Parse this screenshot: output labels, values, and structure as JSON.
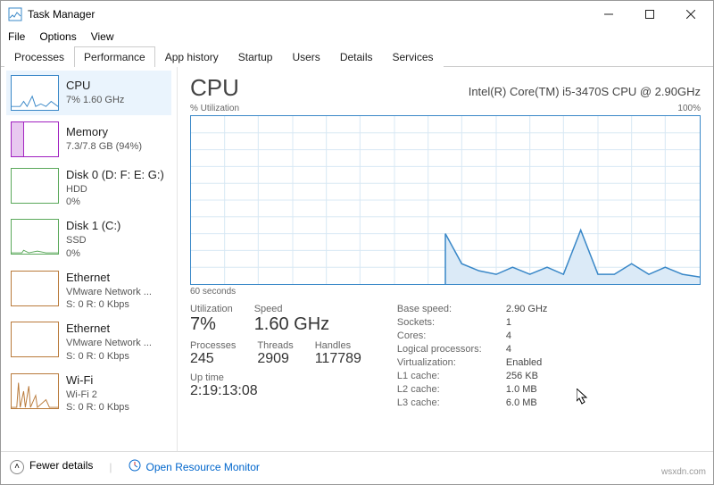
{
  "window": {
    "title": "Task Manager"
  },
  "menu": {
    "file": "File",
    "options": "Options",
    "view": "View"
  },
  "tabs": {
    "processes": "Processes",
    "performance": "Performance",
    "apphistory": "App history",
    "startup": "Startup",
    "users": "Users",
    "details": "Details",
    "services": "Services"
  },
  "sidebar": {
    "items": [
      {
        "name": "CPU",
        "sub1": "7% 1.60 GHz",
        "color": "#3a88c8"
      },
      {
        "name": "Memory",
        "sub1": "7.3/7.8 GB (94%)",
        "color": "#a020c0"
      },
      {
        "name": "Disk 0 (D: F: E: G:)",
        "sub1": "HDD",
        "sub2": "0%",
        "color": "#5aa85a"
      },
      {
        "name": "Disk 1 (C:)",
        "sub1": "SSD",
        "sub2": "0%",
        "color": "#5aa85a"
      },
      {
        "name": "Ethernet",
        "sub1": "VMware Network ...",
        "sub2": "S: 0  R: 0 Kbps",
        "color": "#b97a3a"
      },
      {
        "name": "Ethernet",
        "sub1": "VMware Network ...",
        "sub2": "S: 0  R: 0 Kbps",
        "color": "#b97a3a"
      },
      {
        "name": "Wi-Fi",
        "sub1": "Wi-Fi 2",
        "sub2": "S: 0  R: 0 Kbps",
        "color": "#b97a3a"
      }
    ]
  },
  "main": {
    "title": "CPU",
    "model": "Intel(R) Core(TM) i5-3470S CPU @ 2.90GHz",
    "util_label": "% Utilization",
    "max_label": "100%",
    "time_label": "60 seconds",
    "stats": {
      "utilization": {
        "label": "Utilization",
        "value": "7%"
      },
      "speed": {
        "label": "Speed",
        "value": "1.60 GHz"
      },
      "processes": {
        "label": "Processes",
        "value": "245"
      },
      "threads": {
        "label": "Threads",
        "value": "2909"
      },
      "handles": {
        "label": "Handles",
        "value": "117789"
      },
      "uptime": {
        "label": "Up time",
        "value": "2:19:13:08"
      }
    },
    "kv": {
      "base_speed": {
        "k": "Base speed:",
        "v": "2.90 GHz"
      },
      "sockets": {
        "k": "Sockets:",
        "v": "1"
      },
      "cores": {
        "k": "Cores:",
        "v": "4"
      },
      "logical": {
        "k": "Logical processors:",
        "v": "4"
      },
      "virt": {
        "k": "Virtualization:",
        "v": "Enabled"
      },
      "l1": {
        "k": "L1 cache:",
        "v": "256 KB"
      },
      "l2": {
        "k": "L2 cache:",
        "v": "1.0 MB"
      },
      "l3": {
        "k": "L3 cache:",
        "v": "6.0 MB"
      }
    }
  },
  "footer": {
    "fewer": "Fewer details",
    "resource": "Open Resource Monitor"
  },
  "watermark": "wsxdn.com",
  "chart_data": {
    "type": "line",
    "title": "CPU % Utilization",
    "xlabel": "seconds",
    "ylabel": "% Utilization",
    "xlim": [
      60,
      0
    ],
    "ylim": [
      0,
      100
    ],
    "x": [
      60,
      58,
      56,
      54,
      52,
      50,
      48,
      46,
      44,
      42,
      40,
      38,
      36,
      34,
      32,
      30,
      28,
      26,
      24,
      22,
      20,
      18,
      16,
      14,
      12,
      10,
      8,
      6,
      4,
      2,
      0
    ],
    "values": [
      0,
      0,
      0,
      0,
      0,
      0,
      0,
      0,
      0,
      0,
      0,
      0,
      0,
      0,
      0,
      30,
      12,
      8,
      6,
      10,
      6,
      10,
      6,
      32,
      6,
      6,
      12,
      6,
      10,
      6,
      4
    ]
  }
}
